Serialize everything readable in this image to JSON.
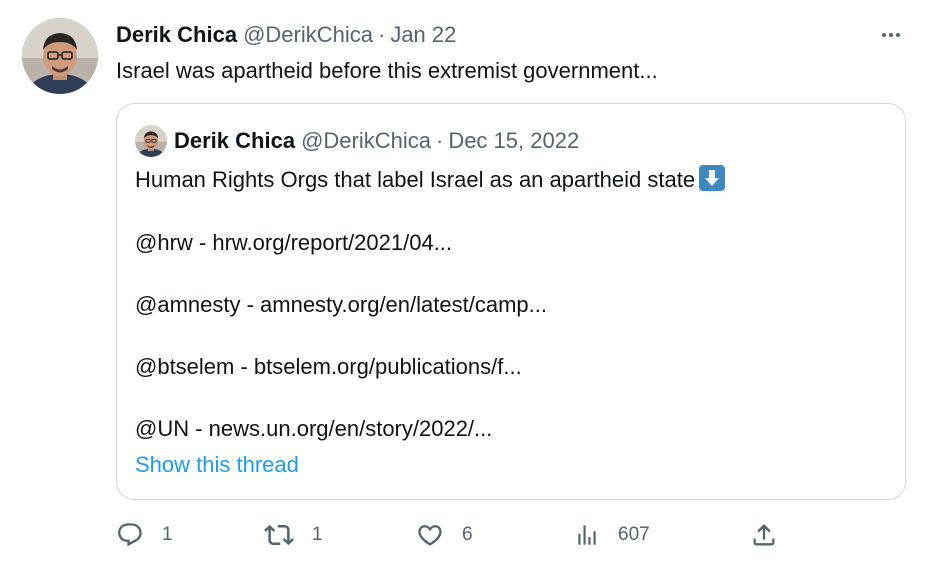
{
  "tweet": {
    "author_name": "Derik Chica",
    "author_handle": "@DerikChica",
    "separator": "·",
    "date": "Jan 22",
    "text": "Israel was apartheid before this extremist government..."
  },
  "quoted_tweet": {
    "author_name": "Derik Chica",
    "author_handle": "@DerikChica",
    "separator": "·",
    "date": "Dec 15, 2022",
    "lines": [
      "Human Rights Orgs that label Israel as an apartheid state",
      "@hrw - hrw.org/report/2021/04...",
      "@amnesty - amnesty.org/en/latest/camp...",
      "@btselem - btselem.org/publications/f...",
      "@UN - news.un.org/en/story/2022/..."
    ],
    "show_thread": "Show this thread"
  },
  "actions": {
    "replies": "1",
    "retweets": "1",
    "likes": "6",
    "views": "607"
  },
  "colors": {
    "text_primary": "#0f1419",
    "text_secondary": "#536471",
    "link": "#1d9bf0",
    "border": "#cfd9de",
    "emoji_blue": "#3b88c3"
  },
  "icons": {
    "more": "more-dots-icon",
    "reply": "reply-icon",
    "retweet": "retweet-icon",
    "like": "heart-icon",
    "views": "views-icon",
    "share": "share-icon",
    "down_arrow_emoji": "down-arrow-emoji-icon"
  }
}
